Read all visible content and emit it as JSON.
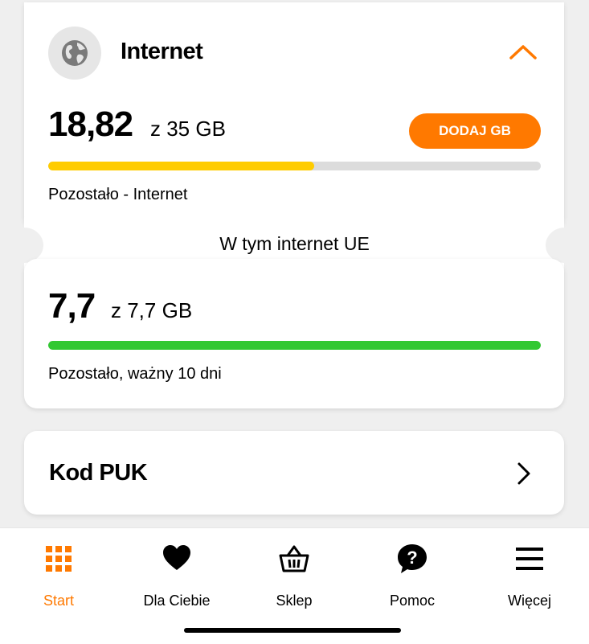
{
  "internet": {
    "title": "Internet",
    "remaining_value": "18,82",
    "total_text": "z 35 GB",
    "add_button_label": "DODAJ GB",
    "progress_fraction": 0.54,
    "caption": "Pozostało - Internet"
  },
  "eu": {
    "title": "W tym internet UE",
    "remaining_value": "7,7",
    "total_text": "z 7,7 GB",
    "progress_fraction": 1.0,
    "caption": "Pozostało, ważny 10 dni"
  },
  "puk": {
    "label": "Kod PUK"
  },
  "tabbar": {
    "items": [
      {
        "label": "Start",
        "icon": "grid-icon",
        "active": true
      },
      {
        "label": "Dla Ciebie",
        "icon": "heart-icon",
        "active": false
      },
      {
        "label": "Sklep",
        "icon": "basket-icon",
        "active": false
      },
      {
        "label": "Pomoc",
        "icon": "help-bubble-icon",
        "active": false
      },
      {
        "label": "Więcej",
        "icon": "menu-icon",
        "active": false
      }
    ]
  },
  "colors": {
    "accent": "#ff7900",
    "internet_bar": "#ffcc00",
    "eu_bar": "#32c832",
    "track": "#dcdcdc",
    "page_bg": "#efefef"
  }
}
